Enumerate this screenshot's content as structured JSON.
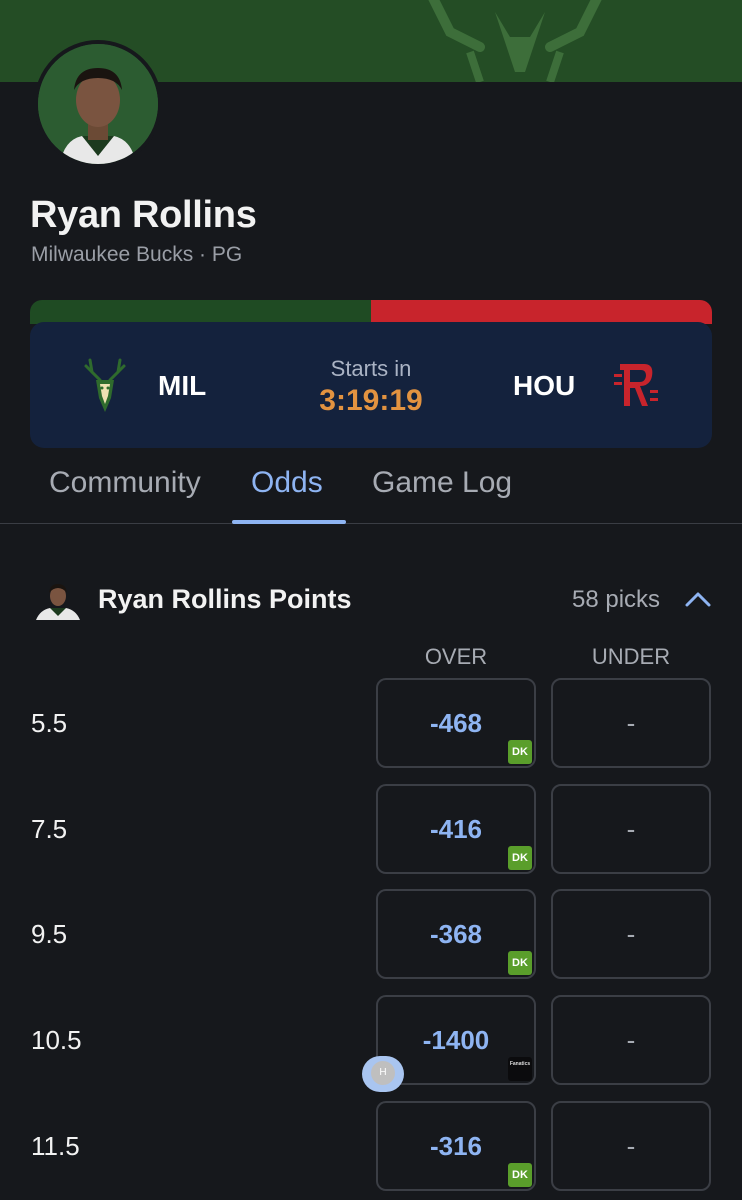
{
  "player": {
    "name": "Ryan Rollins",
    "team_position": "Milwaukee Bucks · PG"
  },
  "colors": {
    "home_team": "#1f4b23",
    "away_team": "#c8242c",
    "accent": "#8eb4f2",
    "countdown": "#e39340"
  },
  "game": {
    "home_abbr": "MIL",
    "away_abbr": "HOU",
    "home_logo_icon": "bucks-logo-icon",
    "away_logo_icon": "rockets-logo-icon",
    "starts_label": "Starts in",
    "countdown": "3:19:19"
  },
  "tabs": [
    {
      "label": "Community",
      "active": false
    },
    {
      "label": "Odds",
      "active": true
    },
    {
      "label": "Game Log",
      "active": false
    }
  ],
  "market": {
    "title": "Ryan Rollins Points",
    "picks": "58 picks",
    "expanded": true,
    "columns": {
      "over": "OVER",
      "under": "UNDER"
    },
    "rows": [
      {
        "line": "5.5",
        "over": "-468",
        "book": "DK",
        "under": "-"
      },
      {
        "line": "7.5",
        "over": "-416",
        "book": "DK",
        "under": "-"
      },
      {
        "line": "9.5",
        "over": "-368",
        "book": "DK",
        "under": "-"
      },
      {
        "line": "10.5",
        "over": "-1400",
        "book": "Fanatics",
        "under": "-"
      },
      {
        "line": "11.5",
        "over": "-316",
        "book": "DK",
        "under": "-"
      }
    ]
  },
  "floating_button": {
    "label": "H"
  }
}
